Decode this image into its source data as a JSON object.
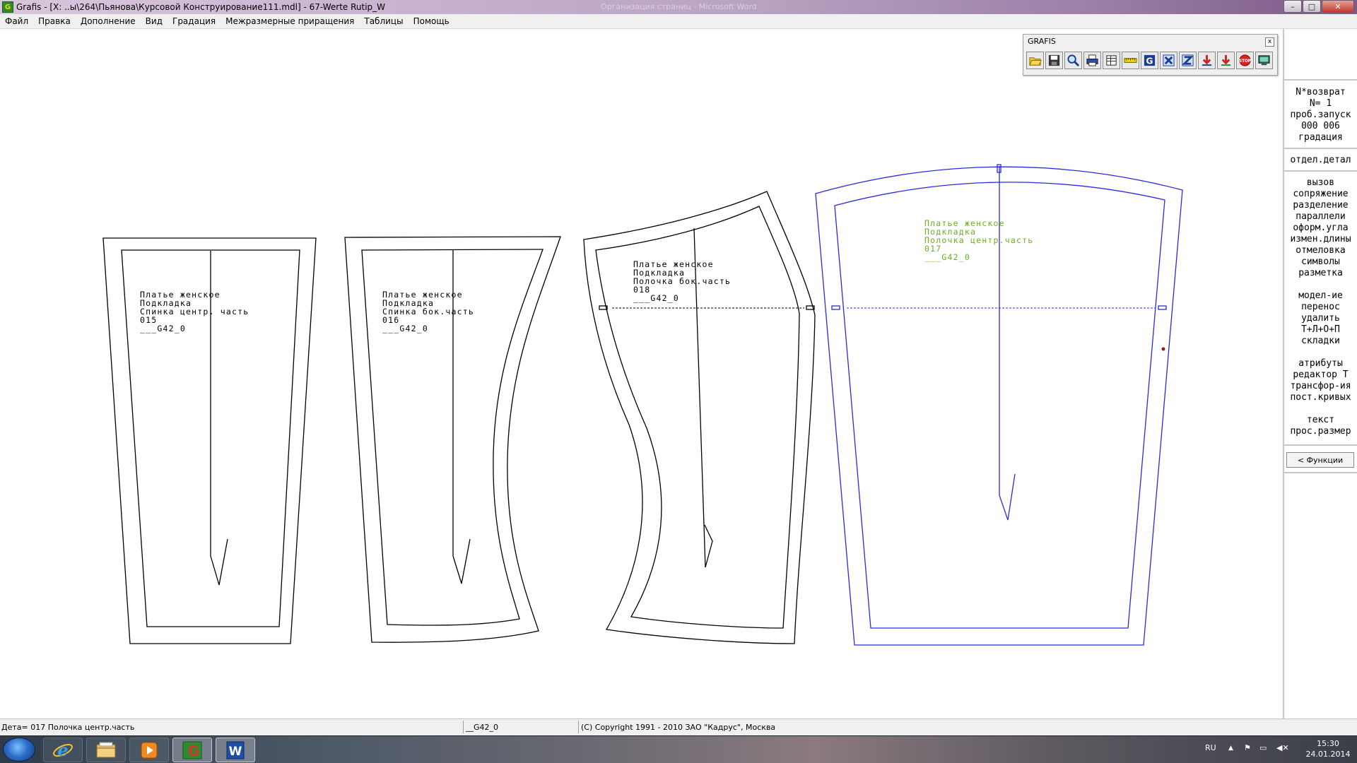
{
  "window": {
    "title": "Grafis - [X: ..ы\\264\\Пьянова\\Курсовой Конструирование111.mdl] - 67-Werte Rutip_W",
    "ghost_title": "Организация страниц - Microsoft Word",
    "app_icon_letter": "G",
    "minimize_glyph": "–",
    "maximize_glyph": "□",
    "close_glyph": "✕"
  },
  "menu": {
    "items": [
      "Файл",
      "Правка",
      "Дополнение",
      "Вид",
      "Градация",
      "Межразмерные приращения",
      "Таблицы",
      "Помощь"
    ]
  },
  "toolbar": {
    "title": "GRAFIS",
    "close_glyph": "x",
    "buttons": [
      {
        "icon": "folder-open-icon",
        "color": "#e0a000"
      },
      {
        "icon": "save-icon",
        "color": "#222222"
      },
      {
        "icon": "magnifier-icon",
        "color": "#1a3d8f"
      },
      {
        "icon": "printer-icon",
        "color": "#1a3d8f"
      },
      {
        "icon": "layout-icon",
        "color": "#222222"
      },
      {
        "icon": "ruler-icon",
        "color": "#d4b000"
      },
      {
        "icon": "grading-icon",
        "color": "#1a3d8f"
      },
      {
        "icon": "export-x-icon",
        "color": "#1a3d8f"
      },
      {
        "icon": "export-z-icon",
        "color": "#1a3d8f"
      },
      {
        "icon": "download-red-icon",
        "color": "#d02020"
      },
      {
        "icon": "download-green-icon",
        "color": "#d02020"
      },
      {
        "icon": "stop-icon",
        "color": "#e02020"
      },
      {
        "icon": "monitor-icon",
        "color": "#1a7a5a"
      }
    ]
  },
  "panel": {
    "header": [
      "N*возврат",
      "N=  1",
      "проб.запуск",
      "000 006",
      "градация"
    ],
    "section1": [
      "отдел.детал"
    ],
    "section2": [
      "вызов",
      "сопряжение",
      "разделение",
      "параллели",
      "оформ.угла",
      "измен.длины",
      "отмеловка",
      "символы",
      "разметка"
    ],
    "section3": [
      "модел-ие",
      "перенос",
      "удалить",
      "Т+Л+О+П",
      "складки"
    ],
    "section4": [
      "атрибуты",
      "редактор Т",
      "трансфор-ия",
      "пост.кривых"
    ],
    "section5": [
      "текст",
      "прос.размер"
    ],
    "functions_button": "< Функции"
  },
  "pieces": [
    {
      "lines": [
        "Платье женское",
        "Подкладка",
        "Спинка центр. часть",
        "015",
        "___G42_0"
      ]
    },
    {
      "lines": [
        "Платье женское",
        "Подкладка",
        "Спинка бок.часть",
        "016",
        "___G42_0"
      ]
    },
    {
      "lines": [
        "Платье женское",
        "Подкладка",
        "Полочка бок.часть",
        "018",
        "___G42_0"
      ]
    },
    {
      "lines": [
        "Платье женское",
        "Подкладка",
        "Полочка центр.часть",
        "017",
        "___G42_0"
      ]
    }
  ],
  "colors": {
    "piece_black": "#000000",
    "piece_selected": "#2a2ae0",
    "label_selected": "#6ab024"
  },
  "status": {
    "detail": "Дета= 017  Полочка центр.часть",
    "size": "__G42_0",
    "copyright": "(С) Copyright 1991 - 2010 ЗАО \"Кадрус\", Москва"
  },
  "taskbar": {
    "apps": [
      {
        "icon": "internet-explorer-icon",
        "label": "e"
      },
      {
        "icon": "file-explorer-icon",
        "label": ""
      },
      {
        "icon": "media-player-icon",
        "label": ""
      },
      {
        "icon": "grafis-app-icon",
        "label": "G"
      },
      {
        "icon": "word-icon",
        "label": "W"
      }
    ],
    "language": "RU",
    "time": "15:30",
    "date": "24.01.2014"
  }
}
